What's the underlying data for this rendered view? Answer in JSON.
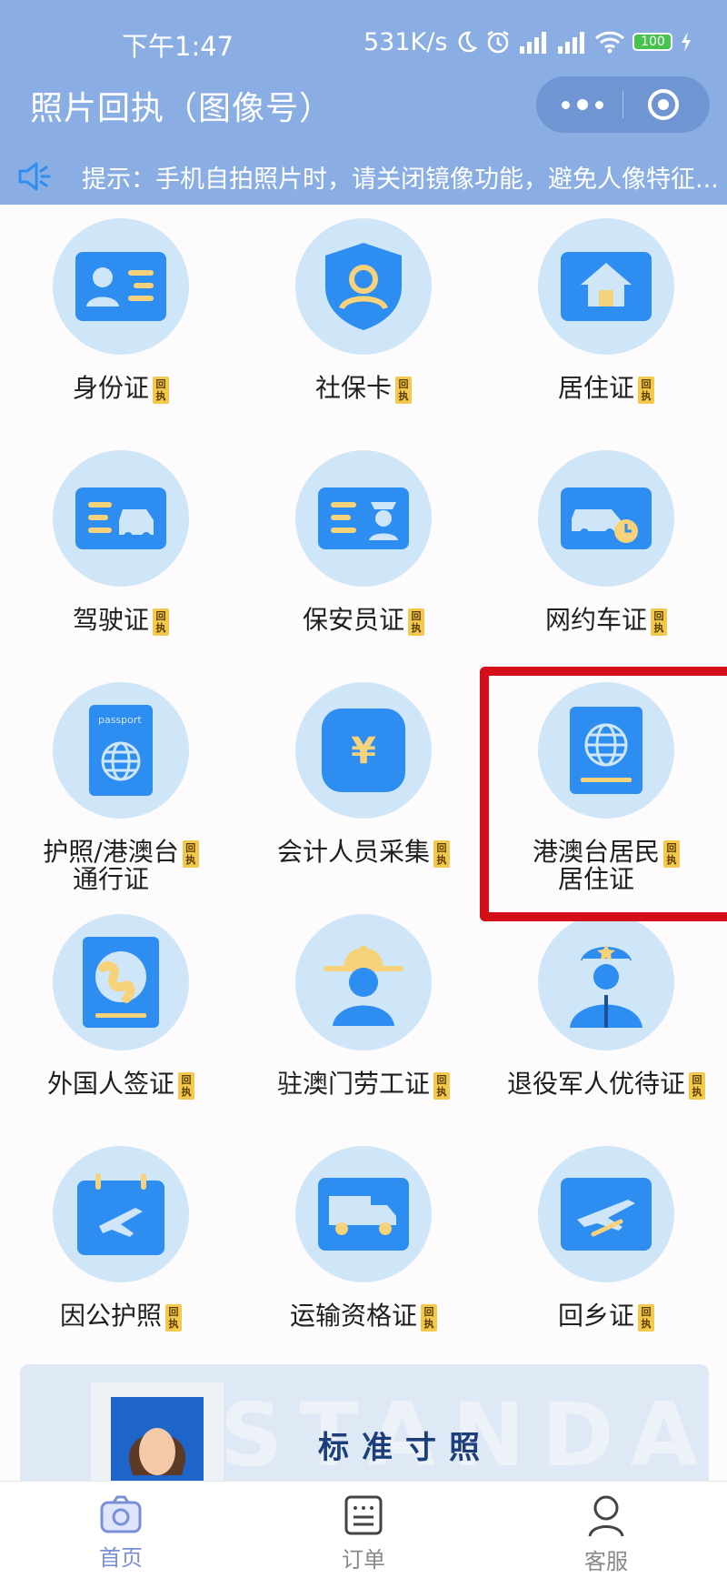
{
  "status": {
    "time": "下午1:47",
    "speed": "531K/s",
    "battery": "100"
  },
  "header": {
    "title": "照片回执（图像号）"
  },
  "notice": {
    "text": "提示：手机自拍照片时，请关闭镜像功能，避免人像特征..."
  },
  "tag_text": [
    "回",
    "执"
  ],
  "services": [
    {
      "label": "身份证",
      "icon": "id-card-icon"
    },
    {
      "label": "社保卡",
      "icon": "social-security-shield-icon"
    },
    {
      "label": "居住证",
      "icon": "house-icon"
    },
    {
      "label": "驾驶证",
      "icon": "car-license-icon"
    },
    {
      "label": "保安员证",
      "icon": "security-guard-card-icon"
    },
    {
      "label": "网约车证",
      "icon": "ride-hailing-car-icon"
    },
    {
      "label": "护照/港澳台\n通行证",
      "icon": "passport-icon",
      "passport_word": "passport"
    },
    {
      "label": "会计人员采集",
      "icon": "yen-icon",
      "yen": "¥"
    },
    {
      "label": "港澳台居民\n居住证",
      "icon": "globe-card-icon"
    },
    {
      "label": "外国人签证",
      "icon": "globe-book-icon"
    },
    {
      "label": "驻澳门劳工证",
      "icon": "worker-helmet-icon"
    },
    {
      "label": "退役军人优待证",
      "icon": "veteran-icon"
    },
    {
      "label": "因公护照",
      "icon": "flight-calendar-icon"
    },
    {
      "label": "运输资格证",
      "icon": "truck-icon"
    },
    {
      "label": "回乡证",
      "icon": "airplane-card-icon"
    }
  ],
  "banner": {
    "title": "标准寸照",
    "watermark": "STANDAR"
  },
  "tabs": [
    {
      "label": "首页",
      "icon": "camera-icon",
      "active": true
    },
    {
      "label": "订单",
      "icon": "order-list-icon",
      "active": false
    },
    {
      "label": "客服",
      "icon": "customer-service-icon",
      "active": false
    }
  ],
  "colors": {
    "header": "#8aaee4",
    "accent": "#2d8df0",
    "tag": "#f2c94c",
    "highlight": "#d40f1a"
  }
}
